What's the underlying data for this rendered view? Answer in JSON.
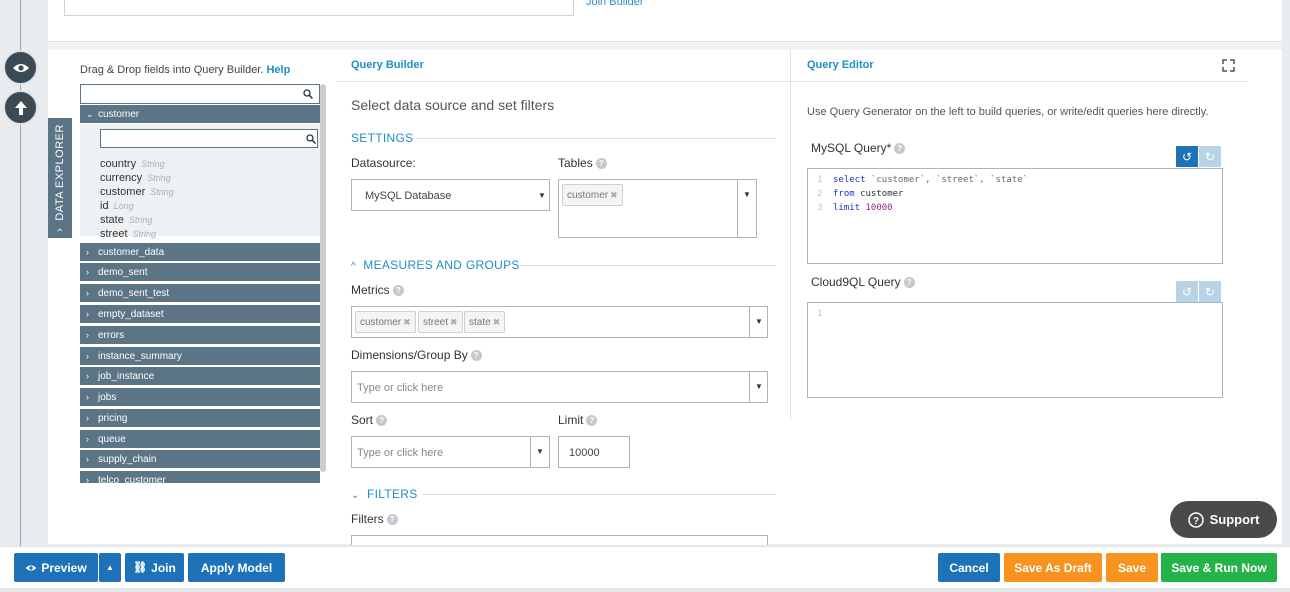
{
  "top": {
    "join_link": "Join Builder"
  },
  "explorer": {
    "tab_label": "DATA EXPLORER",
    "drag_text": "Drag & Drop fields into Query Builder.",
    "help_link": "Help",
    "expanded_table": "customer",
    "fields": [
      {
        "name": "country",
        "type": "String"
      },
      {
        "name": "currency",
        "type": "String"
      },
      {
        "name": "customer",
        "type": "String"
      },
      {
        "name": "id",
        "type": "Long"
      },
      {
        "name": "state",
        "type": "String"
      },
      {
        "name": "street",
        "type": "String"
      }
    ],
    "tables": [
      "customer_data",
      "demo_sent",
      "demo_sent_test",
      "empty_dataset",
      "errors",
      "instance_summary",
      "job_instance",
      "jobs",
      "pricing",
      "queue",
      "supply_chain",
      "telco_customer"
    ]
  },
  "query_builder": {
    "header": "Query Builder",
    "subtitle": "Select data source and set filters",
    "settings_label": "SETTINGS",
    "datasource_label": "Datasource:",
    "datasource_value": "MySQL Database",
    "tables_label": "Tables",
    "tables_chip": "customer",
    "measures_label": "MEASURES AND GROUPS",
    "metrics_label": "Metrics",
    "metrics_chips": [
      "customer",
      "street",
      "state"
    ],
    "dimensions_label": "Dimensions/Group By",
    "dimensions_placeholder": "Type or click here",
    "sort_label": "Sort",
    "sort_placeholder": "Type or click here",
    "limit_label": "Limit",
    "limit_value": "10000",
    "filters_section": "FILTERS",
    "filters_label": "Filters"
  },
  "query_editor": {
    "header": "Query Editor",
    "description": "Use Query Generator on the left to build queries, or write/edit queries here directly.",
    "mysql_label": "MySQL Query*",
    "mysql_lines": [
      "1",
      "2",
      "3"
    ],
    "code": {
      "l1_kw": "select",
      "l1_rest": " `customer`, `street`, `state`",
      "l2_kw": "from",
      "l2_rest": " customer",
      "l3_kw": "limit",
      "l3_num": " 10000"
    },
    "cloud9_label": "Cloud9QL Query",
    "cloud9_line": "1"
  },
  "support_label": "Support",
  "bottom": {
    "preview": "Preview",
    "join": "Join",
    "apply_model": "Apply Model",
    "cancel": "Cancel",
    "save_draft": "Save As Draft",
    "save": "Save",
    "save_run": "Save & Run Now"
  },
  "colors": {
    "node": "#5b7586",
    "accent": "#1e8fc6",
    "blue_button": "#1e73b8",
    "orange_button": "#f7931e",
    "green_button": "#25b24a"
  }
}
